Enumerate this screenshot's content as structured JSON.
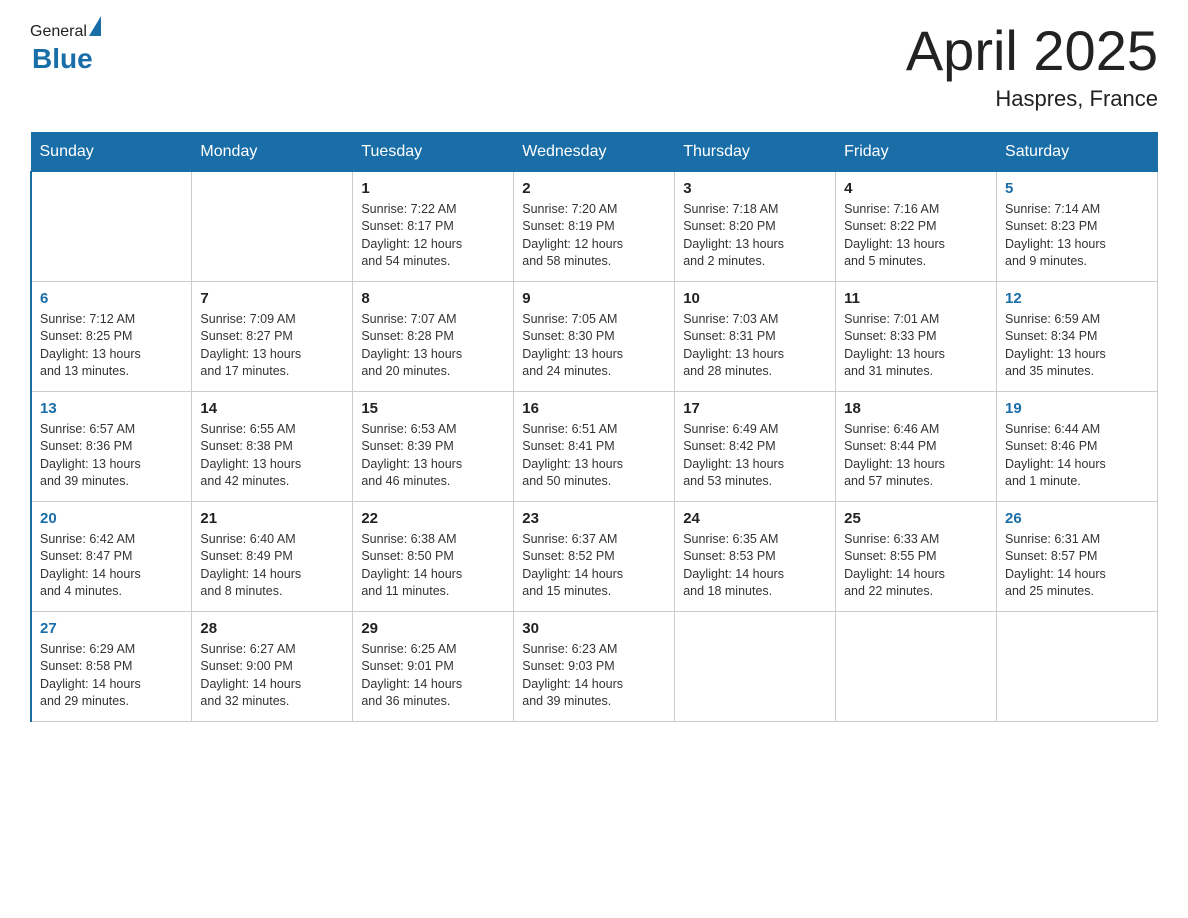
{
  "header": {
    "logo_general": "General",
    "logo_blue": "Blue",
    "month_title": "April 2025",
    "location": "Haspres, France"
  },
  "days_of_week": [
    "Sunday",
    "Monday",
    "Tuesday",
    "Wednesday",
    "Thursday",
    "Friday",
    "Saturday"
  ],
  "weeks": [
    [
      {
        "day": "",
        "info": ""
      },
      {
        "day": "",
        "info": ""
      },
      {
        "day": "1",
        "info": "Sunrise: 7:22 AM\nSunset: 8:17 PM\nDaylight: 12 hours\nand 54 minutes."
      },
      {
        "day": "2",
        "info": "Sunrise: 7:20 AM\nSunset: 8:19 PM\nDaylight: 12 hours\nand 58 minutes."
      },
      {
        "day": "3",
        "info": "Sunrise: 7:18 AM\nSunset: 8:20 PM\nDaylight: 13 hours\nand 2 minutes."
      },
      {
        "day": "4",
        "info": "Sunrise: 7:16 AM\nSunset: 8:22 PM\nDaylight: 13 hours\nand 5 minutes."
      },
      {
        "day": "5",
        "info": "Sunrise: 7:14 AM\nSunset: 8:23 PM\nDaylight: 13 hours\nand 9 minutes."
      }
    ],
    [
      {
        "day": "6",
        "info": "Sunrise: 7:12 AM\nSunset: 8:25 PM\nDaylight: 13 hours\nand 13 minutes."
      },
      {
        "day": "7",
        "info": "Sunrise: 7:09 AM\nSunset: 8:27 PM\nDaylight: 13 hours\nand 17 minutes."
      },
      {
        "day": "8",
        "info": "Sunrise: 7:07 AM\nSunset: 8:28 PM\nDaylight: 13 hours\nand 20 minutes."
      },
      {
        "day": "9",
        "info": "Sunrise: 7:05 AM\nSunset: 8:30 PM\nDaylight: 13 hours\nand 24 minutes."
      },
      {
        "day": "10",
        "info": "Sunrise: 7:03 AM\nSunset: 8:31 PM\nDaylight: 13 hours\nand 28 minutes."
      },
      {
        "day": "11",
        "info": "Sunrise: 7:01 AM\nSunset: 8:33 PM\nDaylight: 13 hours\nand 31 minutes."
      },
      {
        "day": "12",
        "info": "Sunrise: 6:59 AM\nSunset: 8:34 PM\nDaylight: 13 hours\nand 35 minutes."
      }
    ],
    [
      {
        "day": "13",
        "info": "Sunrise: 6:57 AM\nSunset: 8:36 PM\nDaylight: 13 hours\nand 39 minutes."
      },
      {
        "day": "14",
        "info": "Sunrise: 6:55 AM\nSunset: 8:38 PM\nDaylight: 13 hours\nand 42 minutes."
      },
      {
        "day": "15",
        "info": "Sunrise: 6:53 AM\nSunset: 8:39 PM\nDaylight: 13 hours\nand 46 minutes."
      },
      {
        "day": "16",
        "info": "Sunrise: 6:51 AM\nSunset: 8:41 PM\nDaylight: 13 hours\nand 50 minutes."
      },
      {
        "day": "17",
        "info": "Sunrise: 6:49 AM\nSunset: 8:42 PM\nDaylight: 13 hours\nand 53 minutes."
      },
      {
        "day": "18",
        "info": "Sunrise: 6:46 AM\nSunset: 8:44 PM\nDaylight: 13 hours\nand 57 minutes."
      },
      {
        "day": "19",
        "info": "Sunrise: 6:44 AM\nSunset: 8:46 PM\nDaylight: 14 hours\nand 1 minute."
      }
    ],
    [
      {
        "day": "20",
        "info": "Sunrise: 6:42 AM\nSunset: 8:47 PM\nDaylight: 14 hours\nand 4 minutes."
      },
      {
        "day": "21",
        "info": "Sunrise: 6:40 AM\nSunset: 8:49 PM\nDaylight: 14 hours\nand 8 minutes."
      },
      {
        "day": "22",
        "info": "Sunrise: 6:38 AM\nSunset: 8:50 PM\nDaylight: 14 hours\nand 11 minutes."
      },
      {
        "day": "23",
        "info": "Sunrise: 6:37 AM\nSunset: 8:52 PM\nDaylight: 14 hours\nand 15 minutes."
      },
      {
        "day": "24",
        "info": "Sunrise: 6:35 AM\nSunset: 8:53 PM\nDaylight: 14 hours\nand 18 minutes."
      },
      {
        "day": "25",
        "info": "Sunrise: 6:33 AM\nSunset: 8:55 PM\nDaylight: 14 hours\nand 22 minutes."
      },
      {
        "day": "26",
        "info": "Sunrise: 6:31 AM\nSunset: 8:57 PM\nDaylight: 14 hours\nand 25 minutes."
      }
    ],
    [
      {
        "day": "27",
        "info": "Sunrise: 6:29 AM\nSunset: 8:58 PM\nDaylight: 14 hours\nand 29 minutes."
      },
      {
        "day": "28",
        "info": "Sunrise: 6:27 AM\nSunset: 9:00 PM\nDaylight: 14 hours\nand 32 minutes."
      },
      {
        "day": "29",
        "info": "Sunrise: 6:25 AM\nSunset: 9:01 PM\nDaylight: 14 hours\nand 36 minutes."
      },
      {
        "day": "30",
        "info": "Sunrise: 6:23 AM\nSunset: 9:03 PM\nDaylight: 14 hours\nand 39 minutes."
      },
      {
        "day": "",
        "info": ""
      },
      {
        "day": "",
        "info": ""
      },
      {
        "day": "",
        "info": ""
      }
    ]
  ]
}
